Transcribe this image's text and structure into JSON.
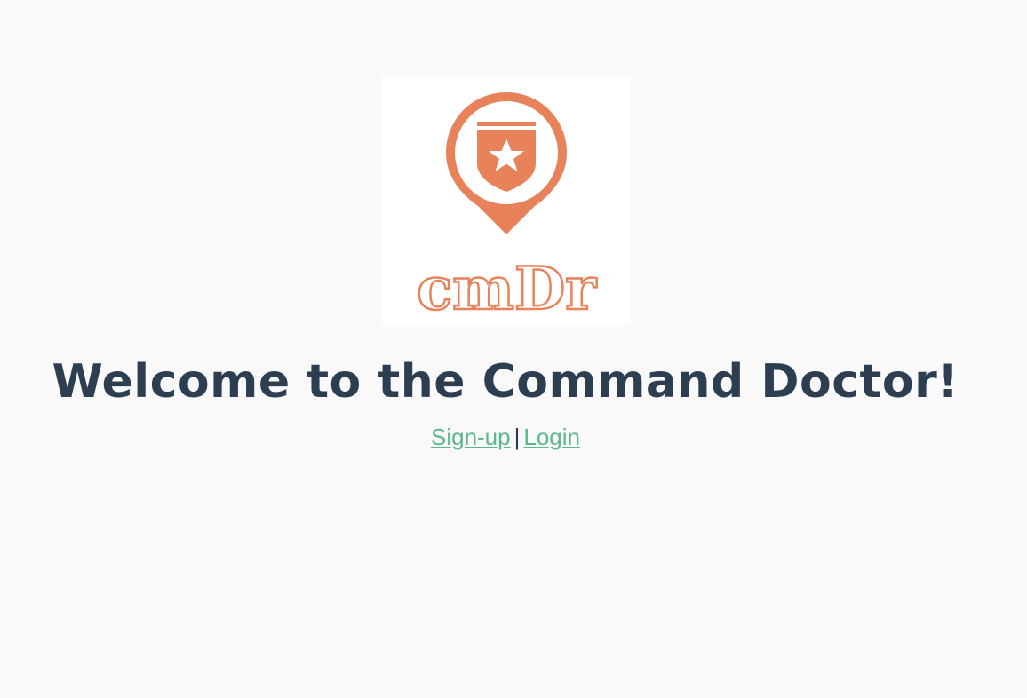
{
  "brand": {
    "logo_text": "cmDr",
    "logo_color": "#e8825a"
  },
  "main": {
    "title": "Welcome to the Command Doctor!",
    "signup_label": "Sign-up",
    "separator": "|",
    "login_label": "Login"
  },
  "colors": {
    "background": "#f9f9f9",
    "title": "#2c3e50",
    "link": "#5cb88a"
  }
}
